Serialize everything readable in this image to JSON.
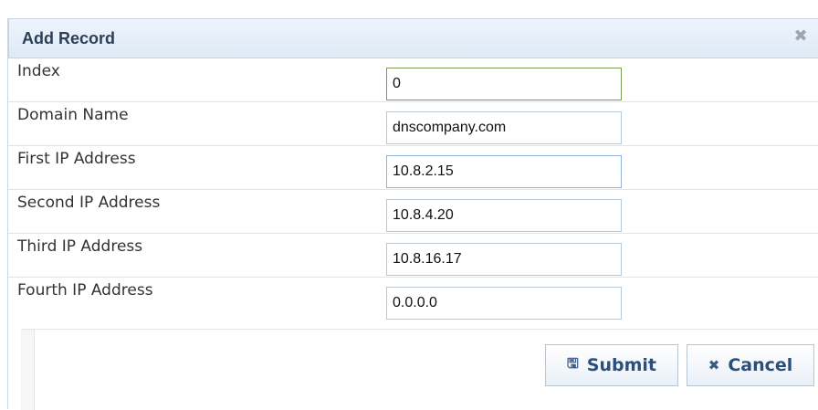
{
  "dialog": {
    "title": "Add Record",
    "close_symbol": "✖",
    "fields": [
      {
        "label": "Index",
        "value": "0"
      },
      {
        "label": "Domain Name",
        "value": "dnscompany.com"
      },
      {
        "label": "First IP Address",
        "value": "10.8.2.15"
      },
      {
        "label": "Second IP Address",
        "value": "10.8.4.20"
      },
      {
        "label": "Third IP Address",
        "value": "10.8.16.17"
      },
      {
        "label": "Fourth IP Address",
        "value": "0.0.0.0"
      }
    ],
    "submit_label": "Submit",
    "submit_icon": "🖫",
    "cancel_label": "Cancel",
    "cancel_icon": "✖"
  },
  "colors": {
    "header_bg": "#dfeaf6",
    "title": "#2b3f57",
    "button_text": "#2b4f7a"
  }
}
